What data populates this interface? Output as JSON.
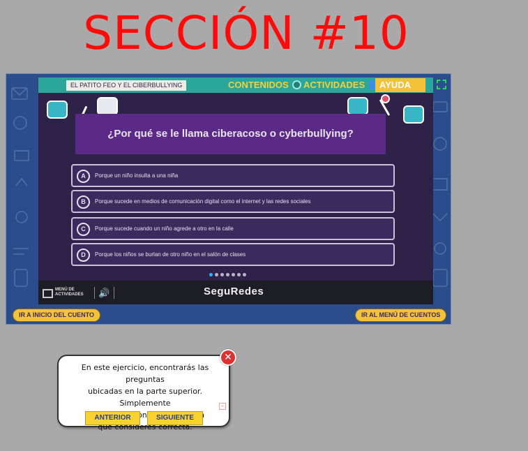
{
  "page": {
    "section_title": "SECCIÓN #10"
  },
  "app": {
    "title_badge": "EL PATITO FEO Y EL CIBERBULLYING",
    "nav": {
      "contenidos": "CONTENIDOS",
      "actividades": "ACTIVIDADES",
      "ayuda": "AYUDA"
    },
    "colors": {
      "frame": "#2b4d8c",
      "topbar": "#2aa69b",
      "stage": "#2e2248",
      "question_panel": "#5b2a86",
      "accent": "#f2c23a"
    }
  },
  "quiz": {
    "question": "¿Por qué se le llama ciberacoso o cyberbullying?",
    "options": [
      {
        "letter": "A",
        "text": "Porque un niño insulta a una niña"
      },
      {
        "letter": "B",
        "text": "Porque sucede en medios de comunicación digital como el internet y las redes sociales"
      },
      {
        "letter": "C",
        "text": "Porque sucede cuando un niño agrede a otro en la calle"
      },
      {
        "letter": "D",
        "text": "Porque los niños se burlan de otro niño en el salón de clases"
      }
    ],
    "pagination": {
      "total": 7,
      "current": 1
    }
  },
  "footer": {
    "menu_label_line1": "MENÚ DE",
    "menu_label_line2": "ACTIVIDADES",
    "brand": "SeguRedes"
  },
  "bottom_buttons": {
    "start": "IR A INICIO DEL CUENTO",
    "menu": "IR AL MENÚ DE CUENTOS"
  },
  "tip": {
    "line1": "En este ejercicio, encontrarás las preguntas",
    "line2": "ubicadas en la parte superior. Simplemente",
    "line3": "debes seleccionar la respuesta",
    "line4": "que consideres correcta.",
    "prev": "ANTERIOR",
    "next": "SIGUIENTE"
  }
}
